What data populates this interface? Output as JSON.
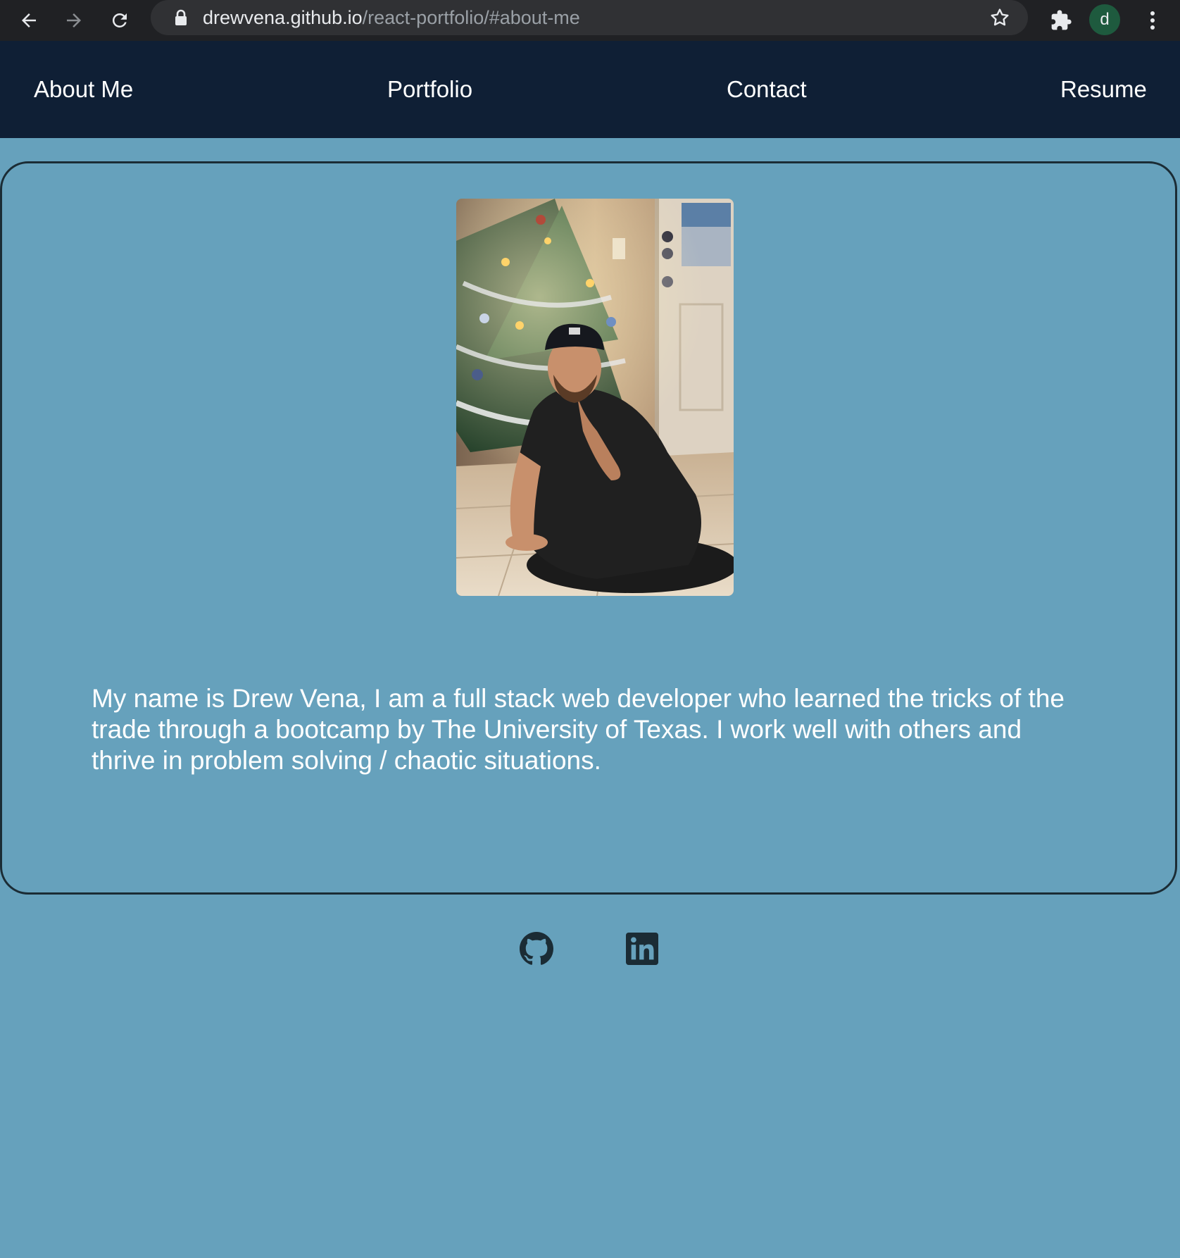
{
  "browser": {
    "url_host": "drewvena.github.io",
    "url_path": "/react-portfolio/#about-me",
    "profile_initial": "d",
    "icons": [
      "back-arrow-icon",
      "forward-arrow-icon",
      "reload-icon",
      "lock-icon",
      "star-icon",
      "puzzle-icon",
      "kebab-menu-icon"
    ]
  },
  "nav": {
    "items": [
      {
        "label": "About Me"
      },
      {
        "label": "Portfolio"
      },
      {
        "label": "Contact"
      },
      {
        "label": "Resume"
      }
    ]
  },
  "about": {
    "photo_icon": "profile-photo",
    "bio": "My name is Drew Vena, I am a full stack web developer who learned the tricks of the trade through a bootcamp by The University of Texas. I work well with others and thrive in problem solving / chaotic situations."
  },
  "footer": {
    "icons": [
      "github-icon",
      "linkedin-icon"
    ]
  },
  "colors": {
    "page_bg": "#66a1bc",
    "nav_bg": "#0f1f35",
    "card_border": "#1b2c35",
    "icon_dark": "#1b2c35"
  }
}
